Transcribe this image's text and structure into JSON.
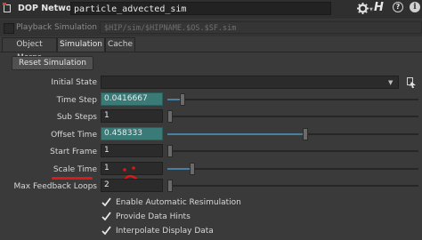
{
  "header": {
    "node_type": "DOP Network",
    "node_name": "particle_advected_sim"
  },
  "playback": {
    "label": "Playback Simulation",
    "checked": false,
    "path": "$HIP/sim/$HIPNAME.$OS.$SF.sim"
  },
  "tabs": [
    {
      "label": "Object Merge"
    },
    {
      "label": "Simulation",
      "active": true
    },
    {
      "label": "Cache"
    }
  ],
  "reset_button": "Reset Simulation",
  "params": {
    "initial_state": {
      "label": "Initial State",
      "value": ""
    },
    "time_step": {
      "label": "Time Step",
      "value": "0.0416667",
      "slider": 0.05
    },
    "sub_steps": {
      "label": "Sub Steps",
      "value": "1",
      "slider": 0.0
    },
    "offset_time": {
      "label": "Offset Time",
      "value": "0.458333",
      "slider": 0.55
    },
    "start_frame": {
      "label": "Start Frame",
      "value": "1",
      "slider": 0.0
    },
    "scale_time": {
      "label": "Scale Time",
      "value": "1",
      "slider": 0.09
    },
    "max_feedback": {
      "label": "Max Feedback Loops",
      "value": "2",
      "slider": 0.0
    }
  },
  "checkboxes": [
    {
      "label": "Enable Automatic Resimulation",
      "checked": true
    },
    {
      "label": "Provide Data Hints",
      "checked": true
    },
    {
      "label": "Interpolate Display Data",
      "checked": true
    }
  ],
  "colors": {
    "teal_field": "#3a7a77",
    "annotation_red": "#d81a1a"
  }
}
